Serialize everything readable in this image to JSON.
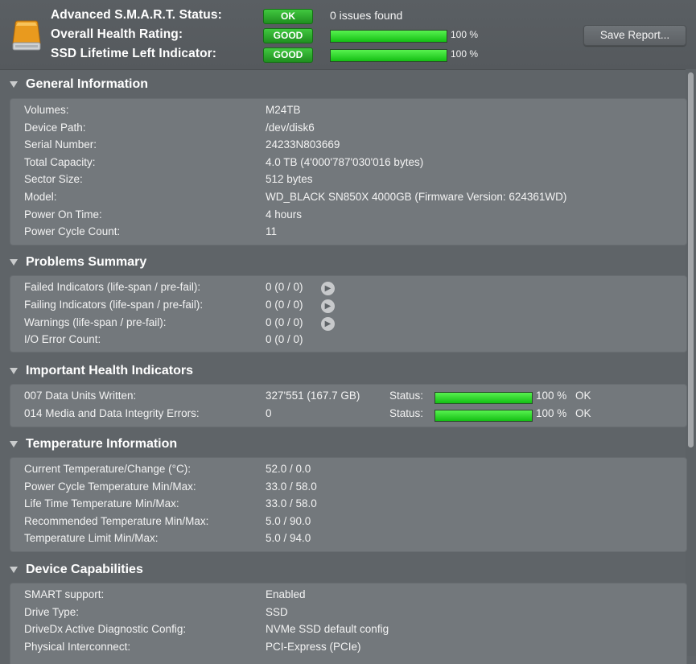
{
  "header": {
    "rows": [
      {
        "label": "Advanced S.M.A.R.T. Status:",
        "badge": "OK",
        "text": "0 issues found"
      },
      {
        "label": "Overall Health Rating:",
        "badge": "GOOD",
        "progress": 1.0,
        "percent": "100 %"
      },
      {
        "label": "SSD Lifetime Left Indicator:",
        "badge": "GOOD",
        "progress": 1.0,
        "percent": "100 %"
      }
    ],
    "save_label": "Save Report..."
  },
  "general": {
    "title": "General Information",
    "rows": [
      {
        "k": "Volumes:",
        "v": "M24TB"
      },
      {
        "k": "Device Path:",
        "v": "/dev/disk6"
      },
      {
        "k": "Serial Number:",
        "v": "24233N803669"
      },
      {
        "k": "Total Capacity:",
        "v": "4.0 TB (4'000'787'030'016 bytes)"
      },
      {
        "k": "Sector Size:",
        "v": "512 bytes"
      },
      {
        "k": "Model:",
        "v": "WD_BLACK SN850X 4000GB  (Firmware Version: 624361WD)"
      },
      {
        "k": "Power On Time:",
        "v": "4 hours"
      },
      {
        "k": "Power Cycle Count:",
        "v": "11"
      }
    ]
  },
  "problems": {
    "title": "Problems Summary",
    "rows": [
      {
        "k": "Failed Indicators (life-span / pre-fail):",
        "v": "0 (0 / 0)"
      },
      {
        "k": "Failing Indicators (life-span / pre-fail):",
        "v": "0 (0 / 0)"
      },
      {
        "k": "Warnings (life-span / pre-fail):",
        "v": "0 (0 / 0)"
      },
      {
        "k": "I/O Error Count:",
        "v": "0 (0 / 0)"
      }
    ]
  },
  "health": {
    "title": "Important Health Indicators",
    "status_label": "Status:",
    "rows": [
      {
        "k": "007  Data Units Written:",
        "v": "327'551 (167.7 GB)",
        "progress": 1.0,
        "percent": "100 %",
        "status": "OK"
      },
      {
        "k": "014  Media and Data Integrity Errors:",
        "v": "0",
        "progress": 1.0,
        "percent": "100 %",
        "status": "OK"
      }
    ]
  },
  "temperature": {
    "title": "Temperature Information",
    "rows": [
      {
        "k": "Current Temperature/Change (°C):",
        "v": "52.0 / 0.0"
      },
      {
        "k": "Power Cycle Temperature Min/Max:",
        "v": "33.0 / 58.0"
      },
      {
        "k": "Life Time Temperature Min/Max:",
        "v": "33.0 / 58.0"
      },
      {
        "k": "Recommended Temperature Min/Max:",
        "v": "5.0   / 90.0"
      },
      {
        "k": "Temperature Limit Min/Max:",
        "v": "5.0   / 94.0"
      }
    ]
  },
  "capabilities": {
    "title": "Device Capabilities",
    "rows": [
      {
        "k": "SMART support:",
        "v": "Enabled"
      },
      {
        "k": "Drive Type:",
        "v": "SSD"
      },
      {
        "k": "DriveDx Active Diagnostic Config:",
        "v": "NVMe SSD default config"
      },
      {
        "k": "Physical Interconnect:",
        "v": "PCI-Express (PCIe)"
      }
    ]
  }
}
